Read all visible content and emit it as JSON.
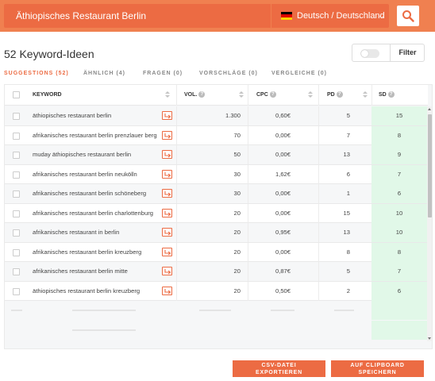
{
  "search": {
    "query": "Äthiopisches Restaurant Berlin",
    "language": "Deutsch / Deutschland",
    "flag_colors": [
      "#000000",
      "#dd0000",
      "#ffce00"
    ]
  },
  "accent_color": "#ec6b43",
  "header": {
    "title": "52 Keyword-Ideen",
    "filter_label": "Filter"
  },
  "tabs": [
    {
      "label": "SUGGESTIONS (52)",
      "active": true
    },
    {
      "label": "ÄHNLICH (4)",
      "active": false
    },
    {
      "label": "FRAGEN (0)",
      "active": false
    },
    {
      "label": "VORSCHLÄGE (0)",
      "active": false
    },
    {
      "label": "VERGLEICHE (0)",
      "active": false
    }
  ],
  "table": {
    "columns": {
      "keyword": "KEYWORD",
      "vol": "VOL.",
      "cpc": "CPC",
      "pd": "PD",
      "sd": "SD"
    },
    "rows": [
      {
        "keyword": "äthiopisches restaurant berlin",
        "vol": "1.300",
        "cpc": "0,60€",
        "pd": "5",
        "sd": "15"
      },
      {
        "keyword": "afrikanisches restaurant berlin prenzlauer berg",
        "vol": "70",
        "cpc": "0,00€",
        "pd": "7",
        "sd": "8"
      },
      {
        "keyword": "muday äthiopisches restaurant berlin",
        "vol": "50",
        "cpc": "0,00€",
        "pd": "13",
        "sd": "9"
      },
      {
        "keyword": "afrikanisches restaurant berlin neukölln",
        "vol": "30",
        "cpc": "1,62€",
        "pd": "6",
        "sd": "7"
      },
      {
        "keyword": "afrikanisches restaurant berlin schöneberg",
        "vol": "30",
        "cpc": "0,00€",
        "pd": "1",
        "sd": "6"
      },
      {
        "keyword": "afrikanisches restaurant berlin charlottenburg",
        "vol": "20",
        "cpc": "0,00€",
        "pd": "15",
        "sd": "10"
      },
      {
        "keyword": "afrikanisches restaurant in berlin",
        "vol": "20",
        "cpc": "0,95€",
        "pd": "13",
        "sd": "10"
      },
      {
        "keyword": "afrikanisches restaurant berlin kreuzberg",
        "vol": "20",
        "cpc": "0,00€",
        "pd": "8",
        "sd": "8"
      },
      {
        "keyword": "afrikanisches restaurant berlin mitte",
        "vol": "20",
        "cpc": "0,87€",
        "pd": "5",
        "sd": "7"
      },
      {
        "keyword": "äthiopisches restaurant berlin kreuzberg",
        "vol": "20",
        "cpc": "0,50€",
        "pd": "2",
        "sd": "6"
      }
    ]
  },
  "buttons": {
    "csv_line1": "CSV-DATEI",
    "csv_line2": "EXPORTIEREN",
    "clip_line1": "AUF CLIPBOARD",
    "clip_line2": "SPEICHERN"
  }
}
